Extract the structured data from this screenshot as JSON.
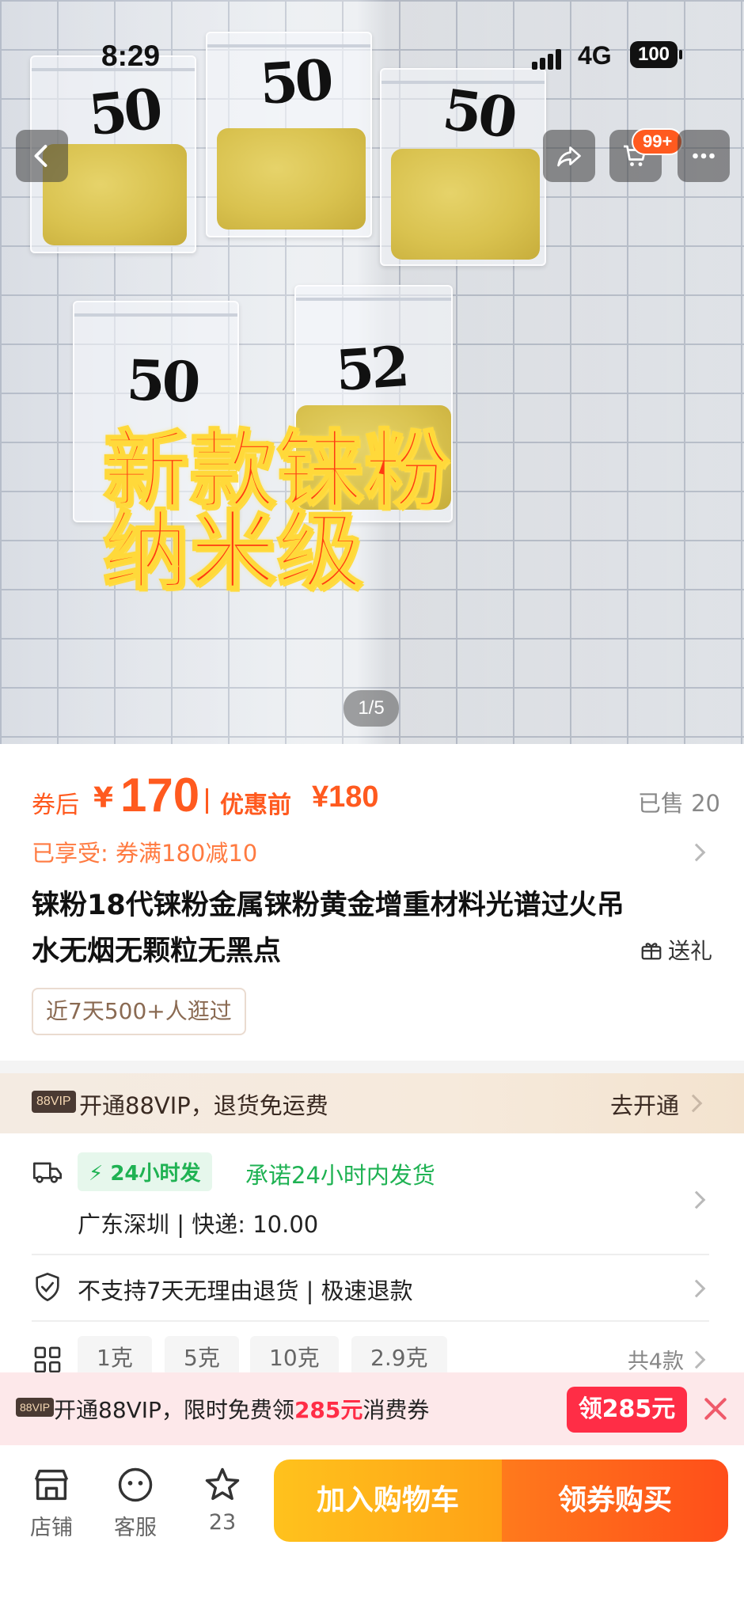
{
  "status_bar": {
    "time": "8:29",
    "network": "4G",
    "battery": "100"
  },
  "nav": {
    "cart_badge": "99+"
  },
  "hero": {
    "bag_labels": [
      "50",
      "50",
      "50",
      "50",
      "52"
    ],
    "overlay_line1": "新款铼粉",
    "overlay_line2": "纳米级",
    "pager": "1/5"
  },
  "price": {
    "after_label": "券后",
    "currency": "¥",
    "after_value": "170",
    "before_label": "优惠前",
    "before_value": "¥180",
    "sold": "已售 20"
  },
  "coupon": {
    "text": "已享受: 券满180减10"
  },
  "product": {
    "title": "铼粉18代铼粉金属铼粉黄金增重材料光谱过火吊水无烟无颗粒无黑点",
    "gift_label": "送礼",
    "viewed": "近7天500+人逛过"
  },
  "vip_bar": {
    "tag": "88VIP",
    "text": "开通88VIP，退货免运费",
    "action": "去开通"
  },
  "shipping": {
    "tag": "24小时发",
    "promise": "承诺24小时内发货",
    "detail": "广东深圳 | 快递: 10.00"
  },
  "returns": {
    "text": "不支持7天无理由退货 | 极速退款"
  },
  "skus": {
    "options": [
      "1克",
      "5克",
      "10克",
      "2.9克"
    ],
    "count": "共4款"
  },
  "promo": {
    "tag": "88VIP",
    "text_prefix": "开通88VIP，限时免费领",
    "amount": "285元",
    "text_suffix": "消费券",
    "button": "领285元"
  },
  "bottom_bar": {
    "shop_label": "店铺",
    "service_label": "客服",
    "favorites_count": "23",
    "cart_button": "加入购物车",
    "buy_button": "领券购买"
  },
  "colors": {
    "accent": "#ff5a1f",
    "green": "#1fb253",
    "promo_red": "#ff2d46"
  }
}
